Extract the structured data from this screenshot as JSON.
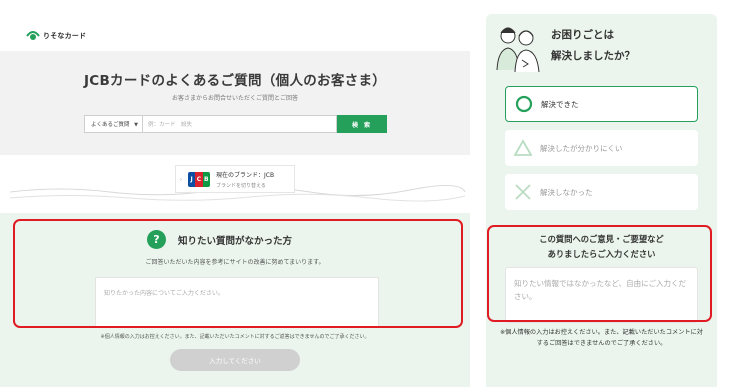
{
  "left": {
    "logo_text": "りそなカード",
    "hero": {
      "title": "JCBカードのよくあるご質問（個人のお客さま）",
      "subtitle": "お客さまからお問合せいただくご質問とご回答"
    },
    "search": {
      "select_value": "よくあるご質問",
      "input_placeholder": "例：カード　紛失",
      "button_label": "検 索"
    },
    "brand": {
      "current": "現在のブランド：JCB",
      "switch_label": "ブランドを切り替える",
      "logo_letters": [
        "J",
        "C",
        "B"
      ]
    },
    "feedback": {
      "icon_glyph": "?",
      "title": "知りたい質問がなかった方",
      "subtitle": "ご回答いただいた内容を参考にサイトの改善に努めてまいります。",
      "textarea_placeholder": "知りたかった内容についてご入力ください。",
      "note": "※個人情報の入力はお控えください。また、記載いただいたコメントに対するご返答はできませんのでご了承ください。",
      "submit_label": "入力してください"
    }
  },
  "right": {
    "title_line1": "お困りごとは",
    "title_line2": "解決しましたか？",
    "options": [
      {
        "label": "解決できた",
        "icon": "circle-icon",
        "selected": true
      },
      {
        "label": "解決したが分かりにくい",
        "icon": "triangle-icon",
        "selected": false
      },
      {
        "label": "解決しなかった",
        "icon": "cross-icon",
        "selected": false
      }
    ],
    "form_title_line1": "この質問へのご意見・ご要望など",
    "form_title_line2": "ありましたらご入力ください",
    "textarea_placeholder": "知りたい情報ではなかったなど、自由にご入力ください。",
    "note": "※個人情報の入力はお控えください。また、記載いただいたコメントに対するご回答はできませんのでご了承ください。"
  },
  "colors": {
    "accent_green": "#24a05a",
    "panel_bg": "#ebf5ed",
    "highlight_red": "#e01b24",
    "disabled_button": "#d0d0d0"
  }
}
